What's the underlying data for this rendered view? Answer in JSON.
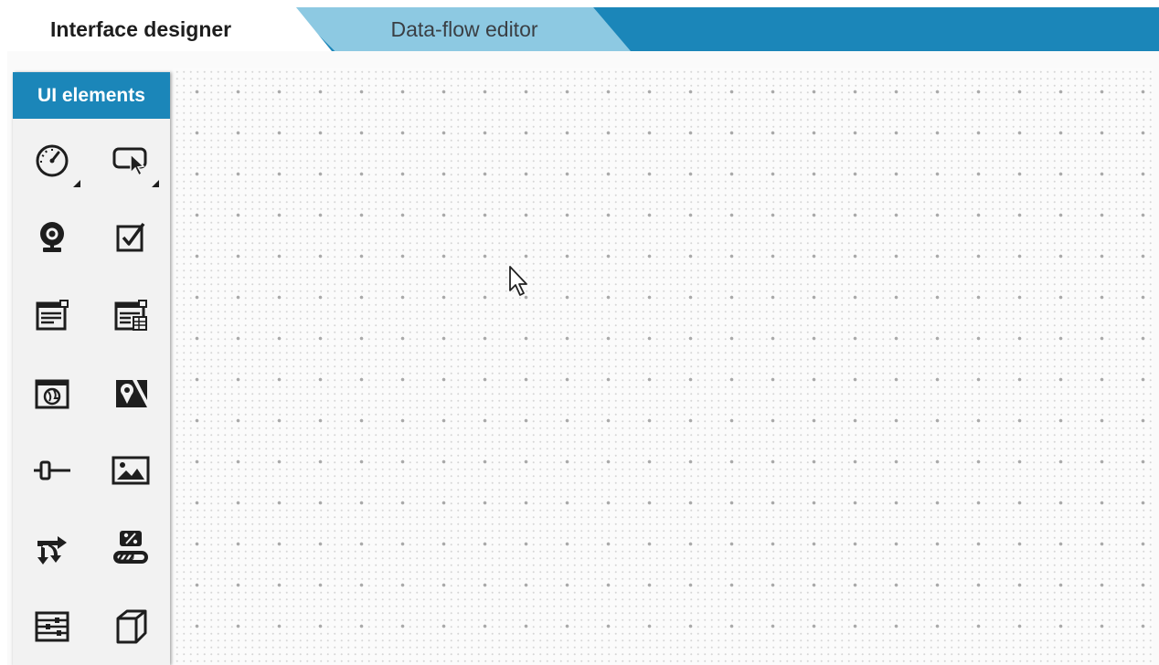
{
  "tabs": [
    {
      "label": "Interface designer",
      "active": true
    },
    {
      "label": "Data-flow editor",
      "active": false
    }
  ],
  "palette": {
    "title": "UI elements",
    "tools": [
      {
        "icon": "gauge-icon",
        "has_submenu": true
      },
      {
        "icon": "touch-button-icon",
        "has_submenu": true
      },
      {
        "icon": "webcam-icon",
        "has_submenu": false
      },
      {
        "icon": "checkbox-icon",
        "has_submenu": false
      },
      {
        "icon": "text-panel-icon",
        "has_submenu": false
      },
      {
        "icon": "data-table-panel-icon",
        "has_submenu": false
      },
      {
        "icon": "web-frame-icon",
        "has_submenu": false
      },
      {
        "icon": "map-icon",
        "has_submenu": false
      },
      {
        "icon": "slider-icon",
        "has_submenu": false
      },
      {
        "icon": "image-icon",
        "has_submenu": false
      },
      {
        "icon": "data-flow-arrows-icon",
        "has_submenu": false
      },
      {
        "icon": "progress-percent-icon",
        "has_submenu": false
      },
      {
        "icon": "settings-list-icon",
        "has_submenu": false
      },
      {
        "icon": "3d-cube-icon",
        "has_submenu": false
      }
    ]
  },
  "colors": {
    "accent": "#1b86b9",
    "tab_inactive": "#8dc9e2",
    "icon": "#1e1e1e"
  }
}
